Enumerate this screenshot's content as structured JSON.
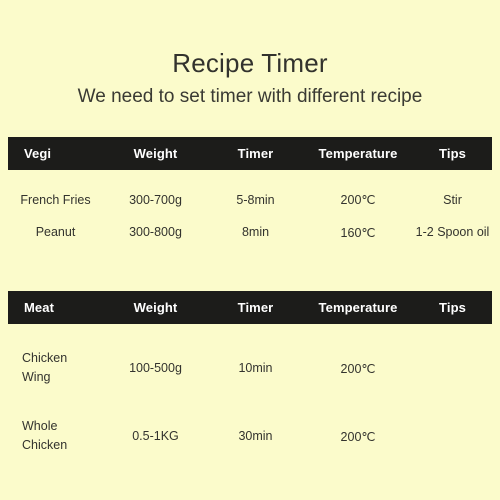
{
  "header": {
    "title": "Recipe Timer",
    "subtitle": "We need to set timer with different recipe"
  },
  "colors": {
    "background": "#FBFBCB",
    "header_bar": "#1C1C1A",
    "header_text": "#FFFFFF",
    "body_text": "#33332E"
  },
  "tables": [
    {
      "id": "vegi",
      "columns": [
        "Vegi",
        "Weight",
        "Timer",
        "Temperature",
        "Tips"
      ],
      "rows": [
        {
          "name": "French Fries",
          "name_line1": "French Fries",
          "name_line2": "",
          "weight": "300-700g",
          "timer": "5-8min",
          "temperature": "200℃",
          "tips": "Stir"
        },
        {
          "name": "Peanut",
          "name_line1": "Peanut",
          "name_line2": "",
          "weight": "300-800g",
          "timer": "8min",
          "temperature": "160℃",
          "tips": "1-2 Spoon oil"
        }
      ]
    },
    {
      "id": "meat",
      "columns": [
        "Meat",
        "Weight",
        "Timer",
        "Temperature",
        "Tips"
      ],
      "rows": [
        {
          "name": "Chicken Wing",
          "name_line1": "Chicken",
          "name_line2": "Wing",
          "weight": "100-500g",
          "timer": "10min",
          "temperature": "200℃",
          "tips": ""
        },
        {
          "name": "Whole Chicken",
          "name_line1": "Whole",
          "name_line2": "Chicken",
          "weight": "0.5-1KG",
          "timer": "30min",
          "temperature": "200℃",
          "tips": ""
        }
      ]
    }
  ]
}
